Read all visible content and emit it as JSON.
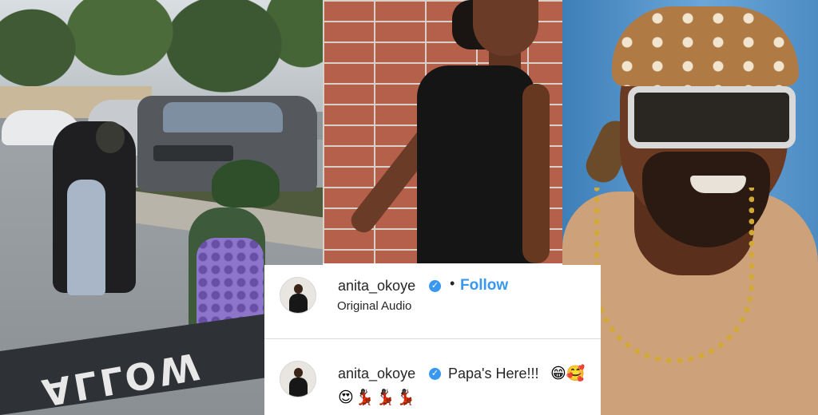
{
  "road_marking": "ALLOW",
  "post": {
    "username": "anita_okoye",
    "separator": "•",
    "follow_label": "Follow",
    "audio_label": "Original Audio",
    "verified_glyph": "✓"
  },
  "comment": {
    "username": "anita_okoye",
    "verified_glyph": "✓",
    "text": "Papa's Here!!!",
    "emojis_line1": "😁🥰",
    "emojis_line2": "😍💃🏿💃🏿💃🏿"
  },
  "colors": {
    "link_blue": "#3897f0",
    "text_dark": "#262626",
    "verified_blue": "#3897f0"
  },
  "icons": [
    "verified-badge-icon",
    "avatar"
  ]
}
